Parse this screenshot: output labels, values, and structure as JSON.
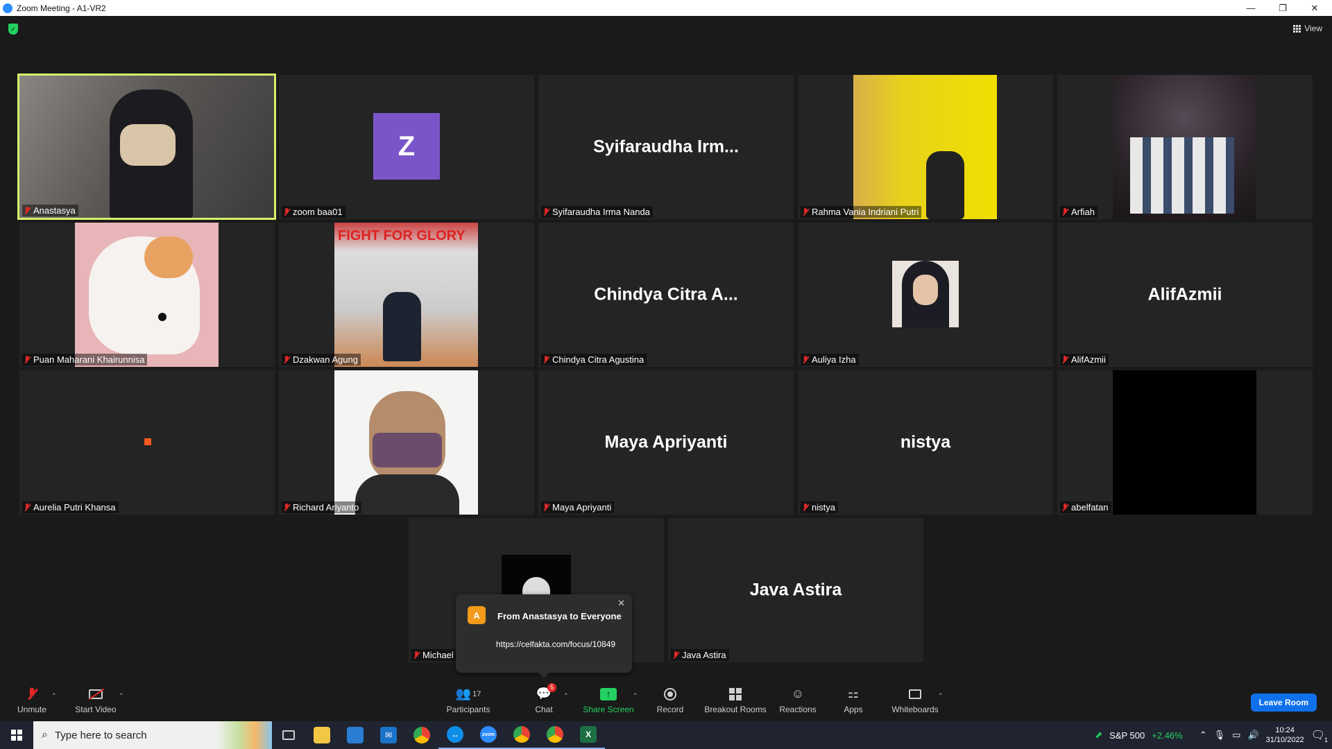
{
  "window": {
    "title": "Zoom Meeting - A1-VR2",
    "minimize": "—",
    "restore": "❐",
    "close": "✕"
  },
  "top_bar": {
    "view_label": "View"
  },
  "participants": [
    {
      "name": "Anastasya"
    },
    {
      "name": "zoom baa01",
      "avatar_letter": "Z"
    },
    {
      "name": "Syifaraudha Irma Nanda",
      "display": "Syifaraudha  Irm..."
    },
    {
      "name": "Rahma Vania Indriani Putri"
    },
    {
      "name": "Arfiah"
    },
    {
      "name": "Puan Maharani Khairunnisa"
    },
    {
      "name": "Dzakwan Agung"
    },
    {
      "name": "Chindya Citra Agustina",
      "display": "Chindya Citra A..."
    },
    {
      "name": "Auliya Izha"
    },
    {
      "name": "AlifAzmii",
      "display": "AlifAzmii"
    },
    {
      "name": "Aurelia Putri Khansa"
    },
    {
      "name": "Richard Ariyanto"
    },
    {
      "name": "Maya Apriyanti",
      "display": "Maya Apriyanti"
    },
    {
      "name": "nistya",
      "display": "nistya"
    },
    {
      "name": "abelfatan"
    },
    {
      "name": "Michael"
    },
    {
      "name": "Java Astira",
      "display": "Java Astira"
    }
  ],
  "chat_notification": {
    "avatar_letter": "A",
    "header": "From Anastasya to Everyone",
    "message": "https://celfakta.com/focus/10849"
  },
  "toolbar": {
    "unmute": "Unmute",
    "start_video": "Start Video",
    "participants": "Participants",
    "participants_count": "17",
    "chat": "Chat",
    "chat_badge": "5",
    "share_screen": "Share Screen",
    "record": "Record",
    "breakout_rooms": "Breakout Rooms",
    "reactions": "Reactions",
    "apps": "Apps",
    "whiteboards": "Whiteboards",
    "leave": "Leave Room"
  },
  "taskbar": {
    "search_placeholder": "Type here to search",
    "stock_name": "S&P 500",
    "stock_change": "+2.46%",
    "time": "10:24",
    "date": "31/10/2022",
    "notification_count": "1"
  },
  "colors": {
    "active_speaker_border": "#d5f26a",
    "leave_button": "#0e71eb",
    "share_screen_green": "#23d160",
    "muted_red": "#e02828",
    "avatar_z": "#7a55c9",
    "chat_avatar": "#f29a1a",
    "stock_green": "#23d160"
  }
}
